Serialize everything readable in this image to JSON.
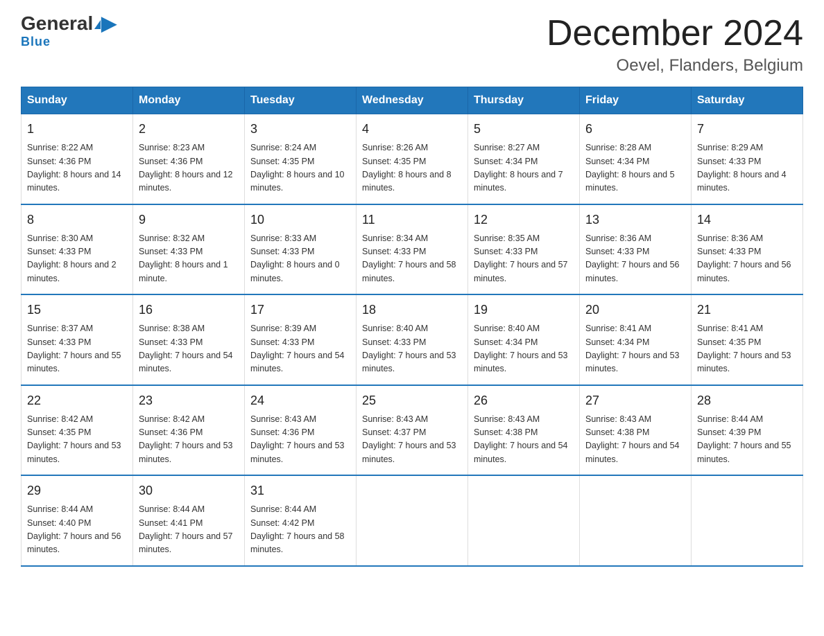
{
  "header": {
    "logo_general": "General",
    "logo_blue": "Blue",
    "month_title": "December 2024",
    "location": "Oevel, Flanders, Belgium"
  },
  "days_of_week": [
    "Sunday",
    "Monday",
    "Tuesday",
    "Wednesday",
    "Thursday",
    "Friday",
    "Saturday"
  ],
  "weeks": [
    [
      {
        "day": "1",
        "sunrise": "8:22 AM",
        "sunset": "4:36 PM",
        "daylight": "8 hours and 14 minutes."
      },
      {
        "day": "2",
        "sunrise": "8:23 AM",
        "sunset": "4:36 PM",
        "daylight": "8 hours and 12 minutes."
      },
      {
        "day": "3",
        "sunrise": "8:24 AM",
        "sunset": "4:35 PM",
        "daylight": "8 hours and 10 minutes."
      },
      {
        "day": "4",
        "sunrise": "8:26 AM",
        "sunset": "4:35 PM",
        "daylight": "8 hours and 8 minutes."
      },
      {
        "day": "5",
        "sunrise": "8:27 AM",
        "sunset": "4:34 PM",
        "daylight": "8 hours and 7 minutes."
      },
      {
        "day": "6",
        "sunrise": "8:28 AM",
        "sunset": "4:34 PM",
        "daylight": "8 hours and 5 minutes."
      },
      {
        "day": "7",
        "sunrise": "8:29 AM",
        "sunset": "4:33 PM",
        "daylight": "8 hours and 4 minutes."
      }
    ],
    [
      {
        "day": "8",
        "sunrise": "8:30 AM",
        "sunset": "4:33 PM",
        "daylight": "8 hours and 2 minutes."
      },
      {
        "day": "9",
        "sunrise": "8:32 AM",
        "sunset": "4:33 PM",
        "daylight": "8 hours and 1 minute."
      },
      {
        "day": "10",
        "sunrise": "8:33 AM",
        "sunset": "4:33 PM",
        "daylight": "8 hours and 0 minutes."
      },
      {
        "day": "11",
        "sunrise": "8:34 AM",
        "sunset": "4:33 PM",
        "daylight": "7 hours and 58 minutes."
      },
      {
        "day": "12",
        "sunrise": "8:35 AM",
        "sunset": "4:33 PM",
        "daylight": "7 hours and 57 minutes."
      },
      {
        "day": "13",
        "sunrise": "8:36 AM",
        "sunset": "4:33 PM",
        "daylight": "7 hours and 56 minutes."
      },
      {
        "day": "14",
        "sunrise": "8:36 AM",
        "sunset": "4:33 PM",
        "daylight": "7 hours and 56 minutes."
      }
    ],
    [
      {
        "day": "15",
        "sunrise": "8:37 AM",
        "sunset": "4:33 PM",
        "daylight": "7 hours and 55 minutes."
      },
      {
        "day": "16",
        "sunrise": "8:38 AM",
        "sunset": "4:33 PM",
        "daylight": "7 hours and 54 minutes."
      },
      {
        "day": "17",
        "sunrise": "8:39 AM",
        "sunset": "4:33 PM",
        "daylight": "7 hours and 54 minutes."
      },
      {
        "day": "18",
        "sunrise": "8:40 AM",
        "sunset": "4:33 PM",
        "daylight": "7 hours and 53 minutes."
      },
      {
        "day": "19",
        "sunrise": "8:40 AM",
        "sunset": "4:34 PM",
        "daylight": "7 hours and 53 minutes."
      },
      {
        "day": "20",
        "sunrise": "8:41 AM",
        "sunset": "4:34 PM",
        "daylight": "7 hours and 53 minutes."
      },
      {
        "day": "21",
        "sunrise": "8:41 AM",
        "sunset": "4:35 PM",
        "daylight": "7 hours and 53 minutes."
      }
    ],
    [
      {
        "day": "22",
        "sunrise": "8:42 AM",
        "sunset": "4:35 PM",
        "daylight": "7 hours and 53 minutes."
      },
      {
        "day": "23",
        "sunrise": "8:42 AM",
        "sunset": "4:36 PM",
        "daylight": "7 hours and 53 minutes."
      },
      {
        "day": "24",
        "sunrise": "8:43 AM",
        "sunset": "4:36 PM",
        "daylight": "7 hours and 53 minutes."
      },
      {
        "day": "25",
        "sunrise": "8:43 AM",
        "sunset": "4:37 PM",
        "daylight": "7 hours and 53 minutes."
      },
      {
        "day": "26",
        "sunrise": "8:43 AM",
        "sunset": "4:38 PM",
        "daylight": "7 hours and 54 minutes."
      },
      {
        "day": "27",
        "sunrise": "8:43 AM",
        "sunset": "4:38 PM",
        "daylight": "7 hours and 54 minutes."
      },
      {
        "day": "28",
        "sunrise": "8:44 AM",
        "sunset": "4:39 PM",
        "daylight": "7 hours and 55 minutes."
      }
    ],
    [
      {
        "day": "29",
        "sunrise": "8:44 AM",
        "sunset": "4:40 PM",
        "daylight": "7 hours and 56 minutes."
      },
      {
        "day": "30",
        "sunrise": "8:44 AM",
        "sunset": "4:41 PM",
        "daylight": "7 hours and 57 minutes."
      },
      {
        "day": "31",
        "sunrise": "8:44 AM",
        "sunset": "4:42 PM",
        "daylight": "7 hours and 58 minutes."
      },
      null,
      null,
      null,
      null
    ]
  ]
}
